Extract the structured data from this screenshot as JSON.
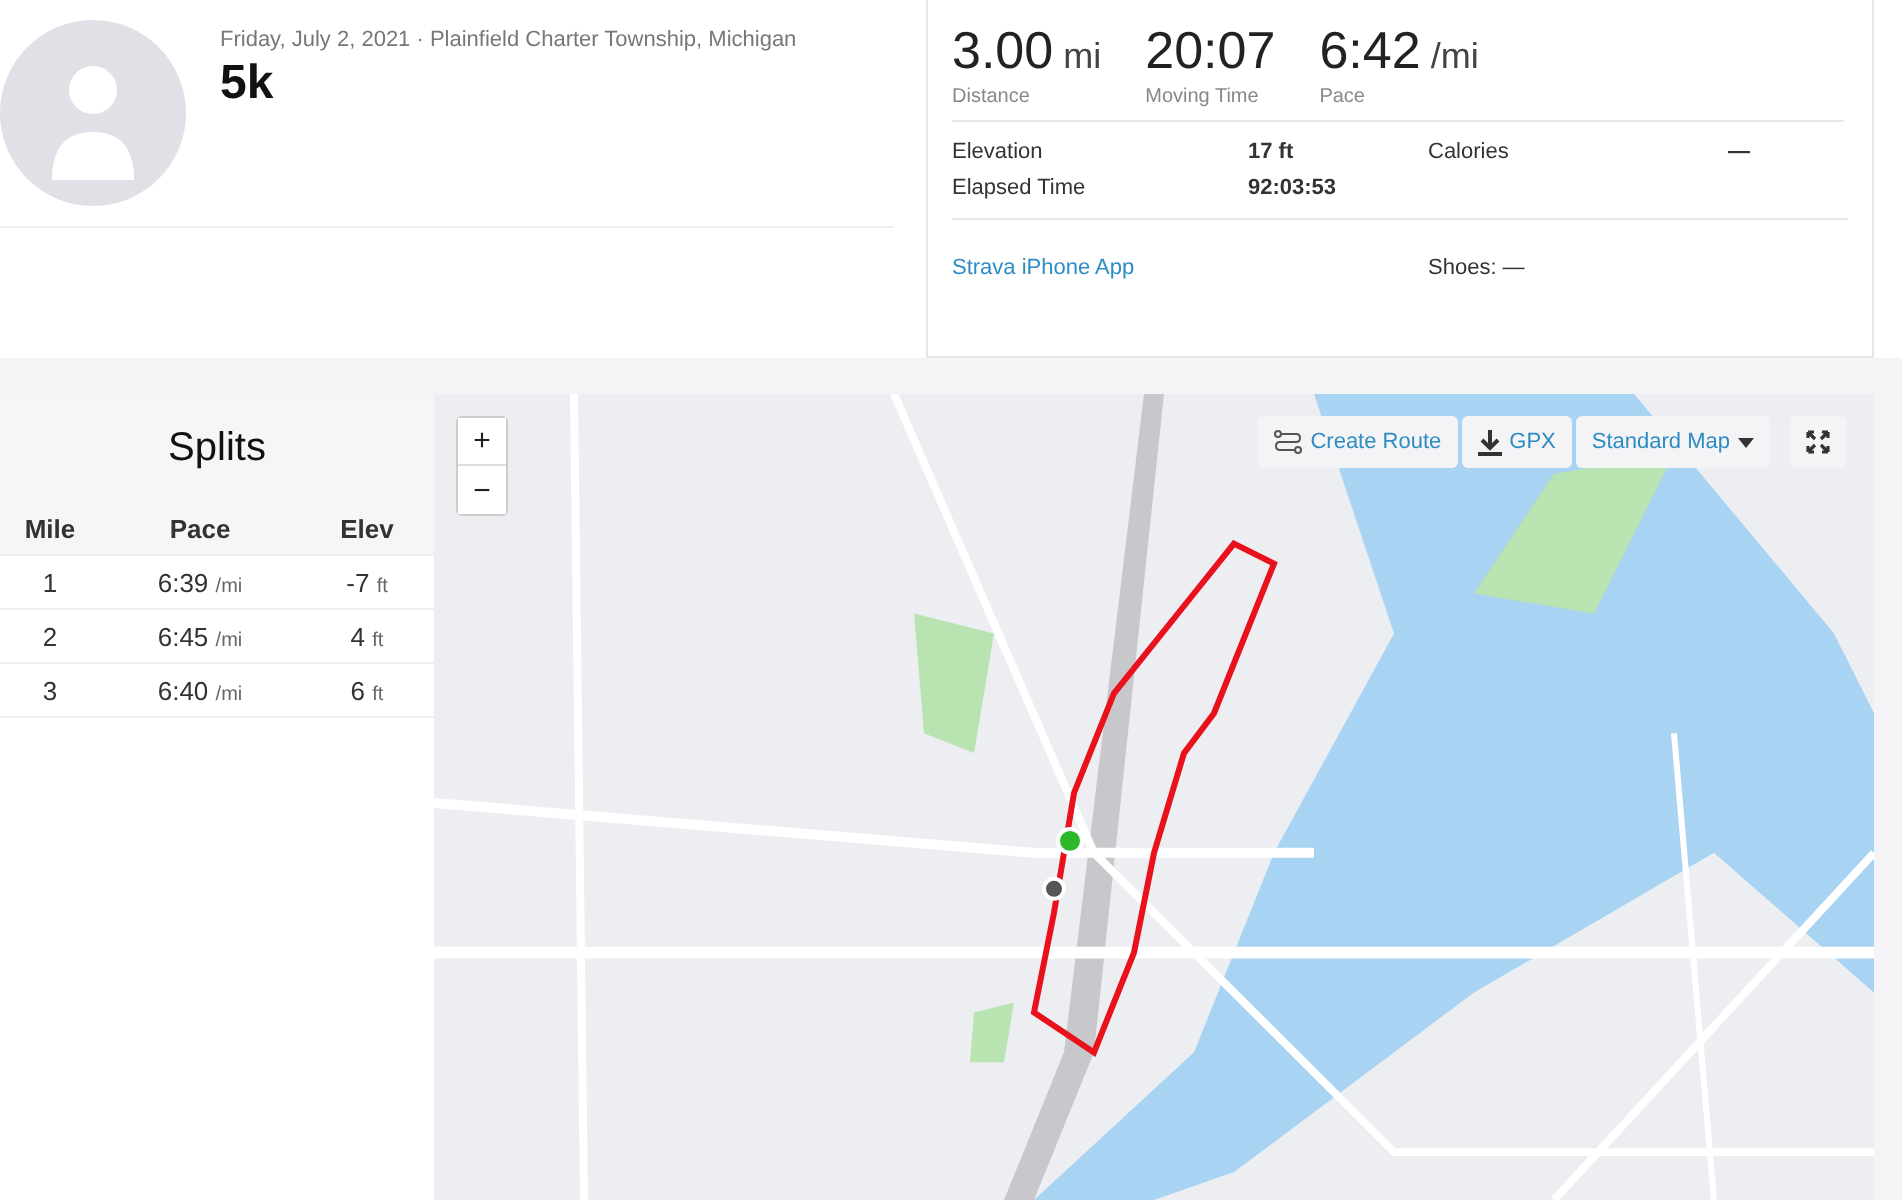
{
  "activity": {
    "meta": "Friday, July 2, 2021 · Plainfield Charter Township, Michigan",
    "title": "5k"
  },
  "stats": {
    "primary": [
      {
        "value": "3.00",
        "unit": "mi",
        "label": "Distance"
      },
      {
        "value": "20:07",
        "label": "Moving Time"
      },
      {
        "value": "6:42",
        "unit": "/mi",
        "label": "Pace"
      }
    ],
    "secondary": [
      {
        "label": "Elevation",
        "value": "17 ft"
      },
      {
        "label": "Calories",
        "value": "—"
      },
      {
        "label": "Elapsed Time",
        "value": "92:03:53"
      }
    ],
    "device": "Strava iPhone App",
    "shoes": "Shoes: —"
  },
  "splits": {
    "title": "Splits",
    "columns": [
      "Mile",
      "Pace",
      "Elev"
    ],
    "rows": [
      {
        "mile": "1",
        "pace": "6:39",
        "pace_unit": "/mi",
        "elev": "-7",
        "elev_unit": "ft"
      },
      {
        "mile": "2",
        "pace": "6:45",
        "pace_unit": "/mi",
        "elev": "4",
        "elev_unit": "ft"
      },
      {
        "mile": "3",
        "pace": "6:40",
        "pace_unit": "/mi",
        "elev": "6",
        "elev_unit": "ft"
      }
    ]
  },
  "map": {
    "kind": "picture",
    "zoom_in": "+",
    "zoom_out": "−",
    "create_route": "Create Route",
    "gpx": "GPX",
    "map_style": "Standard Map"
  }
}
